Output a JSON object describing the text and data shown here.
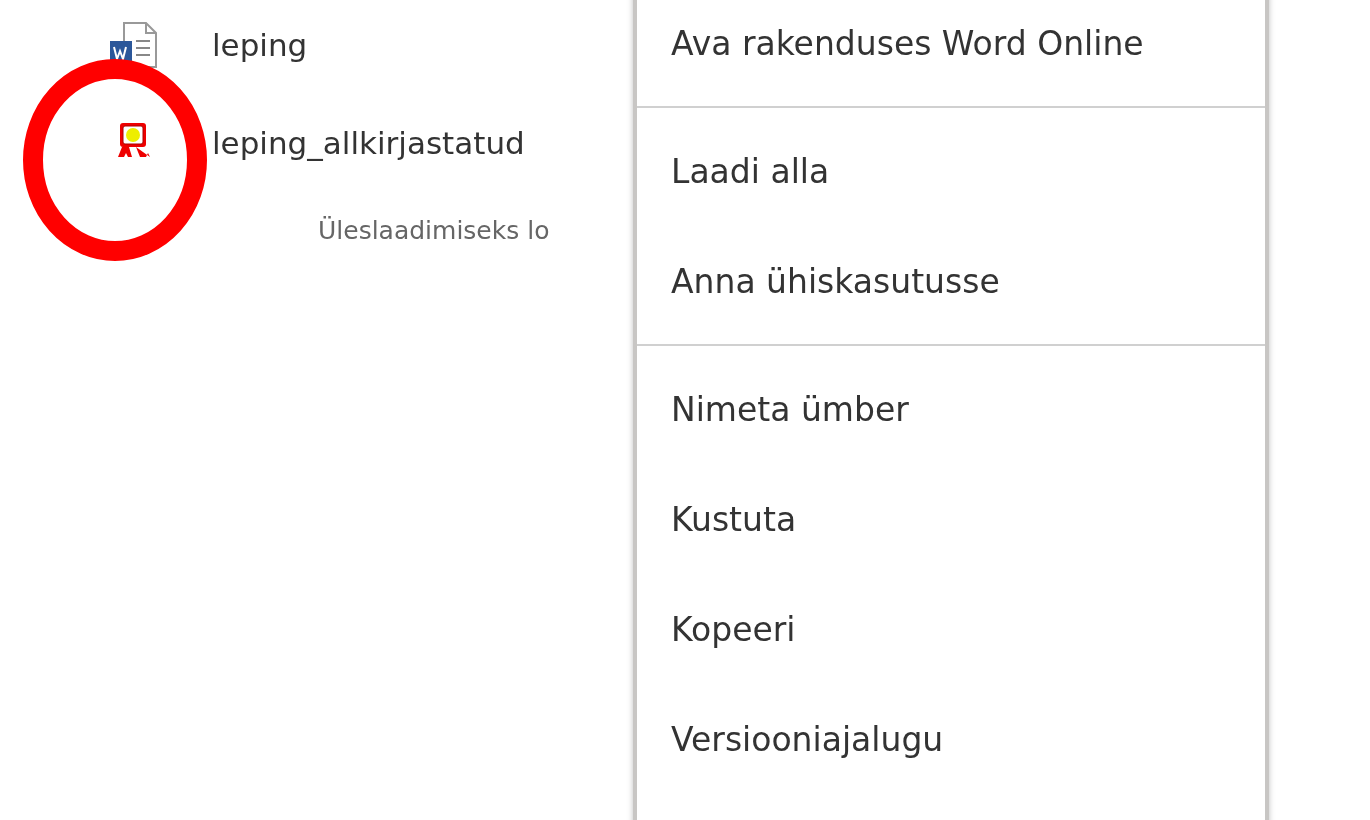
{
  "files": [
    {
      "name": "leping",
      "kind": "word"
    },
    {
      "name": "leping_allkirjastatud",
      "kind": "signed"
    }
  ],
  "upload_hint": "Üleslaadimiseks lo",
  "context_menu": {
    "groups": [
      [
        "Ava rakenduses Word Online"
      ],
      [
        "Laadi alla",
        "Anna ühiskasutusse"
      ],
      [
        "Nimeta ümber",
        "Kustuta",
        "Kopeeri",
        "Versiooniajalugu"
      ]
    ]
  },
  "annotation": {
    "kind": "ellipse"
  }
}
